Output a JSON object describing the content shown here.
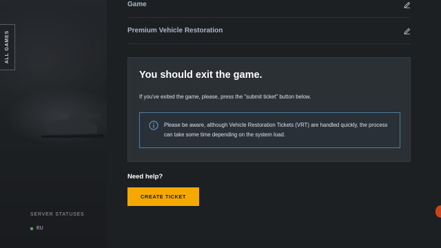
{
  "sidebar": {
    "all_games_label": "ALL GAMES",
    "server_statuses_title": "SERVER STATUSES",
    "servers": [
      {
        "label": "EU",
        "status_color": "#46b450"
      }
    ]
  },
  "form": {
    "rows": [
      {
        "label": "Game",
        "icon": "pencil-icon"
      },
      {
        "label": "Premium Vehicle Restoration",
        "icon": "pencil-icon"
      }
    ]
  },
  "notice": {
    "title": "You should exit the game.",
    "description": "If you've exited the game, please, press the \"submit ticket\" button below.",
    "info_icon": "info-circle-icon",
    "info_text": "Please be aware, although Vehicle Restoration Tickets (VRT) are handled quickly, the process can take some time depending on the system load."
  },
  "help": {
    "title": "Need help?",
    "button_label": "CREATE TICKET"
  },
  "colors": {
    "accent": "#f5a900",
    "info_border": "#4f7f9f",
    "background": "#1d2023"
  }
}
